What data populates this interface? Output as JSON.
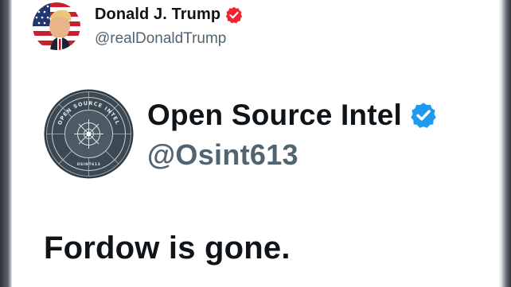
{
  "author": {
    "display_name": "Donald J. Trump",
    "handle": "@realDonaldTrump",
    "verified": true,
    "badge_color": "#f4212e"
  },
  "quoted_account": {
    "display_name": "Open Source Intel",
    "handle": "@Osint613",
    "verified": true,
    "badge_color": "#1d9bf0",
    "logo": {
      "ring_text": "OPEN SOURCE INTEL",
      "inner_text": "OSINT613"
    }
  },
  "post": {
    "text": "Fordow is gone."
  },
  "colors": {
    "primary_text": "#0f1419",
    "secondary_text": "#536471",
    "background": "#ffffff"
  }
}
